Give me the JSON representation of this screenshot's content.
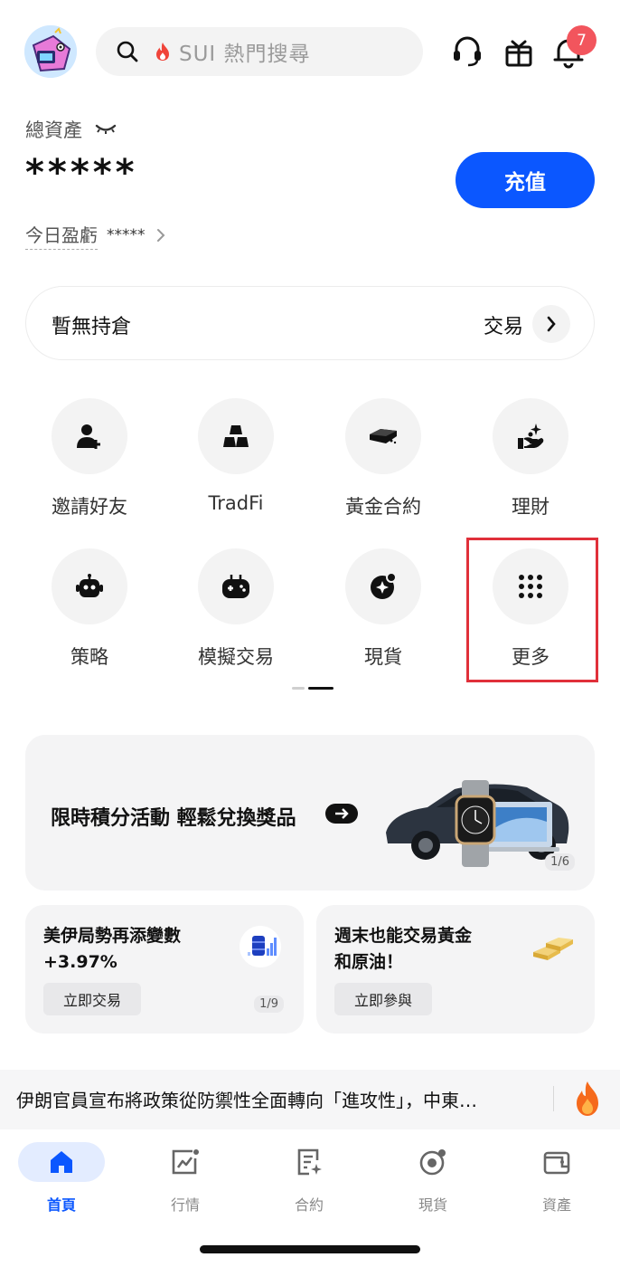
{
  "header": {
    "search_placeholder": "SUI 熱門搜尋",
    "notification_count": "7"
  },
  "assets": {
    "label": "總資產",
    "value": "*****",
    "deposit_label": "充值",
    "pnl_label": "今日盈虧",
    "pnl_value": "*****"
  },
  "positions": {
    "empty_text": "暫無持倉",
    "trade_label": "交易"
  },
  "shortcuts": [
    {
      "label": "邀請好友",
      "icon": "invite-friend-icon"
    },
    {
      "label": "TradFi",
      "icon": "gold-bars-icon"
    },
    {
      "label": "黃金合約",
      "icon": "gold-ingot-icon"
    },
    {
      "label": "理財",
      "icon": "wealth-icon"
    },
    {
      "label": "策略",
      "icon": "robot-icon"
    },
    {
      "label": "模擬交易",
      "icon": "gamepad-icon"
    },
    {
      "label": "現貨",
      "icon": "spot-coin-icon"
    },
    {
      "label": "更多",
      "icon": "more-grid-icon"
    }
  ],
  "promo": {
    "text": "限時積分活動 輕鬆兌換獎品",
    "pager": "1/6"
  },
  "cards": [
    {
      "title_line1": "美伊局勢再添變數",
      "title_line2": "+3.97%",
      "button": "立即交易",
      "pager": "1/9",
      "icon": "oil-barrel-chart-icon"
    },
    {
      "title_line1": "週末也能交易黃金",
      "title_line2": "和原油！",
      "button": "立即參與",
      "icon": "gold-bars-icon"
    }
  ],
  "news": {
    "text": "伊朗官員宣布將政策從防禦性全面轉向「進攻性」，中東…"
  },
  "tabbar": [
    {
      "label": "首頁",
      "icon": "home-icon",
      "active": true
    },
    {
      "label": "行情",
      "icon": "market-chart-icon",
      "active": false
    },
    {
      "label": "合約",
      "icon": "contract-doc-icon",
      "active": false
    },
    {
      "label": "現貨",
      "icon": "spot-icon",
      "active": false
    },
    {
      "label": "資產",
      "icon": "wallet-icon",
      "active": false
    }
  ],
  "colors": {
    "accent": "#0b57ff",
    "badge": "#f2555d",
    "highlight": "#e0303a"
  }
}
